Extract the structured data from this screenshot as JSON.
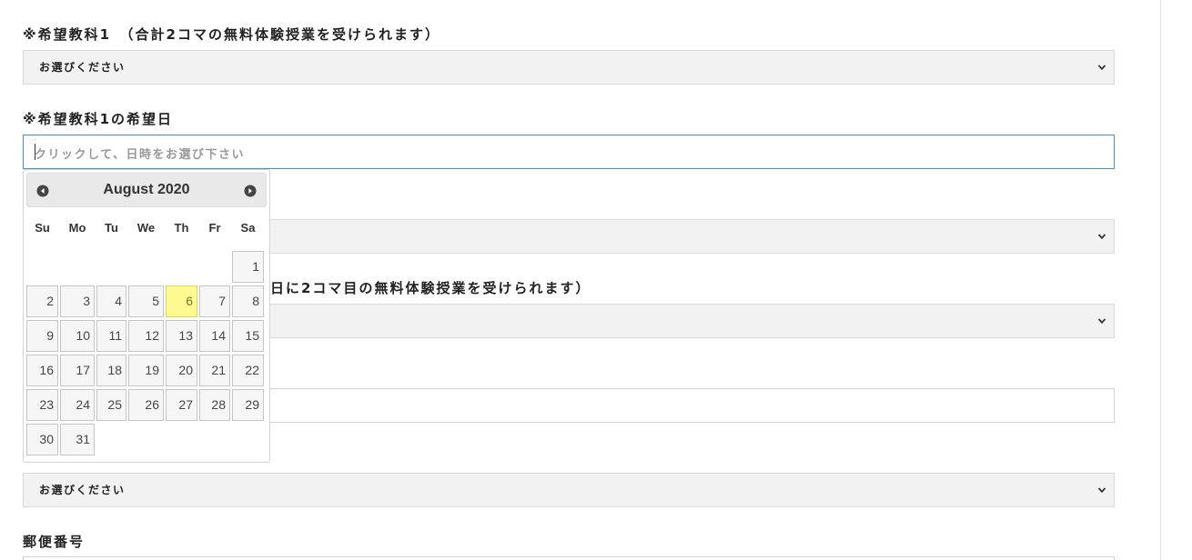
{
  "form": {
    "subject1_label": "※希望教科1　（合計2コマの無料体験授業を受けられます）",
    "subject1_select": "お選びください",
    "date1_label": "※希望教科1の希望日",
    "date1_placeholder": "クリックして、日時をお選び下さい",
    "subject2_label_visible": "日に2コマ目の無料体験授業を受けられます）",
    "bottom_select": "お選びください",
    "postal_label": "郵便番号"
  },
  "datepicker": {
    "title": "August 2020",
    "weekdays": [
      "Su",
      "Mo",
      "Tu",
      "We",
      "Th",
      "Fr",
      "Sa"
    ],
    "days": [
      "1",
      "2",
      "3",
      "4",
      "5",
      "6",
      "7",
      "8",
      "9",
      "10",
      "11",
      "12",
      "13",
      "14",
      "15",
      "16",
      "17",
      "18",
      "19",
      "20",
      "21",
      "22",
      "23",
      "24",
      "25",
      "26",
      "27",
      "28",
      "29",
      "30",
      "31"
    ],
    "first_weekday": 6,
    "today": "6"
  },
  "colors": {
    "today_highlight": "#fffa90",
    "focus_border": "#4a90c8"
  },
  "icons": {
    "prev": "circle-triangle-left-icon",
    "next": "circle-triangle-right-icon",
    "select_arrow": "chevron-down-icon"
  }
}
